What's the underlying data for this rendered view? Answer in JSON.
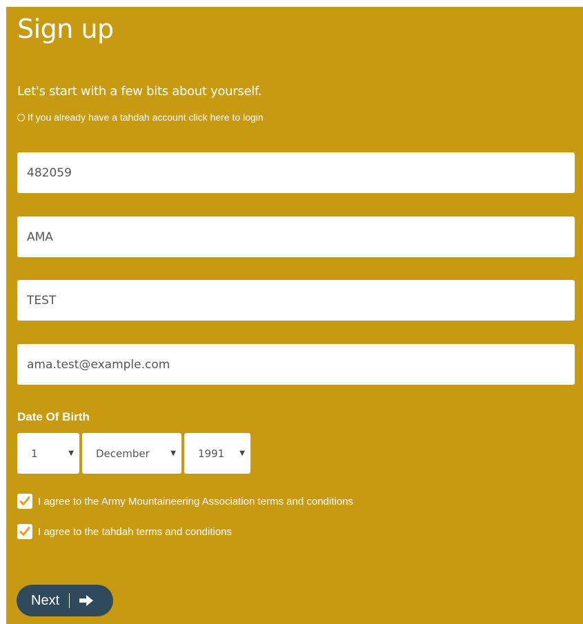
{
  "header": {
    "title": "Sign up"
  },
  "intro": {
    "text": "Let's start with a few bits about yourself.",
    "login_link": "If you already have a tahdah account click here to login"
  },
  "fields": {
    "membership_number": "482059",
    "first_name": "AMA",
    "last_name": "TEST",
    "email": "ama.test@example.com"
  },
  "dob": {
    "label": "Date Of Birth",
    "day": "1",
    "month": "December",
    "year": "1991"
  },
  "agreements": [
    {
      "label": "I agree to the Army Mountaineering Association terms and conditions",
      "checked": true
    },
    {
      "label": "I agree to the tahdah terms and conditions",
      "checked": true
    }
  ],
  "actions": {
    "next_label": "Next",
    "next_icon": "arrow-right-icon"
  },
  "colors": {
    "panel_bg": "#c79a12",
    "button_bg": "#2f4a5a",
    "checkmark": "#e89b2a"
  }
}
